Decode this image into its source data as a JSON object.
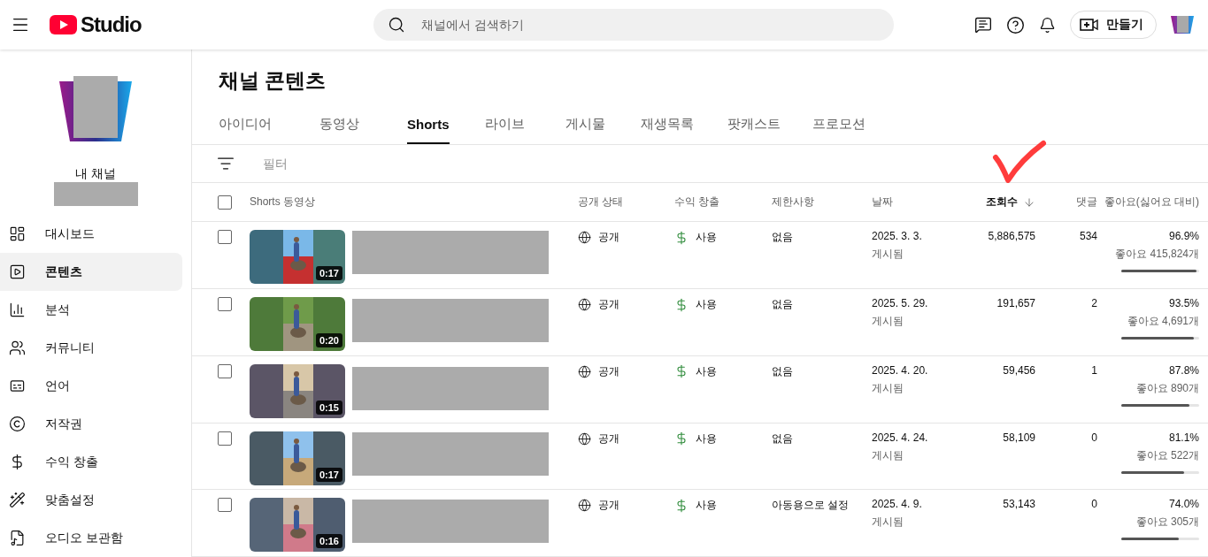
{
  "header": {
    "logo_text": "Studio",
    "search": {
      "placeholder": "채널에서 검색하기"
    },
    "create_button": "만들기"
  },
  "channel": {
    "label": "내 채널"
  },
  "sidebar": {
    "items": [
      {
        "label": "대시보드",
        "selected": false
      },
      {
        "label": "콘텐츠",
        "selected": true
      },
      {
        "label": "분석",
        "selected": false
      },
      {
        "label": "커뮤니티",
        "selected": false
      },
      {
        "label": "언어",
        "selected": false
      },
      {
        "label": "저작권",
        "selected": false
      },
      {
        "label": "수익 창출",
        "selected": false
      },
      {
        "label": "맞춤설정",
        "selected": false
      },
      {
        "label": "오디오 보관함",
        "selected": false
      }
    ]
  },
  "page_title": "채널 콘텐츠",
  "tabs": [
    {
      "label": "아이디어",
      "selected": false
    },
    {
      "label": "동영상",
      "selected": false
    },
    {
      "label": "Shorts",
      "selected": true
    },
    {
      "label": "라이브",
      "selected": false
    },
    {
      "label": "게시물",
      "selected": false
    },
    {
      "label": "재생목록",
      "selected": false
    },
    {
      "label": "팟캐스트",
      "selected": false
    },
    {
      "label": "프로모션",
      "selected": false
    }
  ],
  "filter": {
    "placeholder": "필터"
  },
  "table": {
    "select_all_checked": false,
    "columns": [
      {
        "label": "Shorts 동영상",
        "sorted": false
      },
      {
        "label": "공개 상태",
        "sorted": false
      },
      {
        "label": "수익 창출",
        "sorted": false
      },
      {
        "label": "제한사항",
        "sorted": false
      },
      {
        "label": "날짜",
        "sorted": false
      },
      {
        "label": "조회수",
        "sorted": true
      },
      {
        "label": "댓글",
        "sorted": false
      },
      {
        "label": "좋아요(싫어요 대비)",
        "sorted": false
      }
    ],
    "rows": [
      {
        "checked": false,
        "duration": "0:17",
        "visibility": "공개",
        "monetization": "사용",
        "restrictions": "없음",
        "date": "2025. 3. 3.",
        "date_status": "게시됨",
        "views": "5,886,575",
        "comments": "534",
        "like_ratio": "96.9%",
        "likes": "좋아요 415,824개",
        "level": 0.969
      },
      {
        "checked": false,
        "duration": "0:20",
        "visibility": "공개",
        "monetization": "사용",
        "restrictions": "없음",
        "date": "2025. 5. 29.",
        "date_status": "게시됨",
        "views": "191,657",
        "comments": "2",
        "like_ratio": "93.5%",
        "likes": "좋아요 4,691개",
        "level": 0.935
      },
      {
        "checked": false,
        "duration": "0:15",
        "visibility": "공개",
        "monetization": "사용",
        "restrictions": "없음",
        "date": "2025. 4. 20.",
        "date_status": "게시됨",
        "views": "59,456",
        "comments": "1",
        "like_ratio": "87.8%",
        "likes": "좋아요 890개",
        "level": 0.878
      },
      {
        "checked": false,
        "duration": "0:17",
        "visibility": "공개",
        "monetization": "사용",
        "restrictions": "없음",
        "date": "2025. 4. 24.",
        "date_status": "게시됨",
        "views": "58,109",
        "comments": "0",
        "like_ratio": "81.1%",
        "likes": "좋아요 522개",
        "level": 0.811
      },
      {
        "checked": false,
        "duration": "0:16",
        "visibility": "공개",
        "monetization": "사용",
        "restrictions": "아동용으로 설정",
        "date": "2025. 4. 9.",
        "date_status": "게시됨",
        "views": "53,143",
        "comments": "0",
        "like_ratio": "74.0%",
        "likes": "좋아요 305개",
        "level": 0.74
      }
    ]
  }
}
